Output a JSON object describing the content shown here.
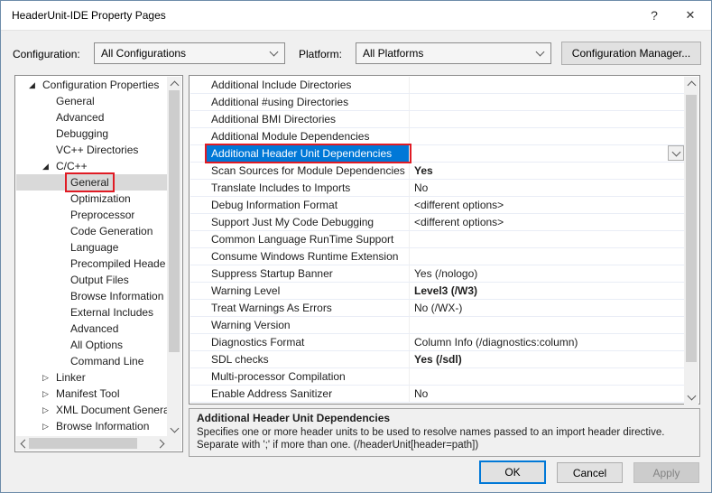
{
  "window": {
    "title": "HeaderUnit-IDE Property Pages",
    "help_icon": "?",
    "close_icon": "✕"
  },
  "toolbar": {
    "configuration_label": "Configuration:",
    "configuration_value": "All Configurations",
    "platform_label": "Platform:",
    "platform_value": "All Platforms",
    "configuration_manager_label": "Configuration Manager..."
  },
  "tree": {
    "items": [
      {
        "label": "Configuration Properties",
        "level": 0,
        "expander": "expanded"
      },
      {
        "label": "General",
        "level": 1,
        "expander": "none"
      },
      {
        "label": "Advanced",
        "level": 1,
        "expander": "none"
      },
      {
        "label": "Debugging",
        "level": 1,
        "expander": "none"
      },
      {
        "label": "VC++ Directories",
        "level": 1,
        "expander": "none"
      },
      {
        "label": "C/C++",
        "level": 1,
        "expander": "expanded"
      },
      {
        "label": "General",
        "level": 2,
        "expander": "none",
        "selected": true,
        "redbox": true
      },
      {
        "label": "Optimization",
        "level": 2,
        "expander": "none"
      },
      {
        "label": "Preprocessor",
        "level": 2,
        "expander": "none"
      },
      {
        "label": "Code Generation",
        "level": 2,
        "expander": "none"
      },
      {
        "label": "Language",
        "level": 2,
        "expander": "none"
      },
      {
        "label": "Precompiled Heade",
        "level": 2,
        "expander": "none"
      },
      {
        "label": "Output Files",
        "level": 2,
        "expander": "none"
      },
      {
        "label": "Browse Information",
        "level": 2,
        "expander": "none"
      },
      {
        "label": "External Includes",
        "level": 2,
        "expander": "none"
      },
      {
        "label": "Advanced",
        "level": 2,
        "expander": "none"
      },
      {
        "label": "All Options",
        "level": 2,
        "expander": "none"
      },
      {
        "label": "Command Line",
        "level": 2,
        "expander": "none"
      },
      {
        "label": "Linker",
        "level": 1,
        "expander": "collapsed"
      },
      {
        "label": "Manifest Tool",
        "level": 1,
        "expander": "collapsed"
      },
      {
        "label": "XML Document Genera",
        "level": 1,
        "expander": "collapsed"
      },
      {
        "label": "Browse Information",
        "level": 1,
        "expander": "collapsed"
      }
    ]
  },
  "grid": {
    "rows": [
      {
        "name": "Additional Include Directories",
        "value": ""
      },
      {
        "name": "Additional #using Directories",
        "value": ""
      },
      {
        "name": "Additional BMI Directories",
        "value": ""
      },
      {
        "name": "Additional Module Dependencies",
        "value": ""
      },
      {
        "name": "Additional Header Unit Dependencies",
        "value": "",
        "selected": true,
        "redbox": true,
        "dropdown": true
      },
      {
        "name": "Scan Sources for Module Dependencies",
        "value": "Yes",
        "bold": true
      },
      {
        "name": "Translate Includes to Imports",
        "value": "No"
      },
      {
        "name": "Debug Information Format",
        "value": "<different options>"
      },
      {
        "name": "Support Just My Code Debugging",
        "value": "<different options>"
      },
      {
        "name": "Common Language RunTime Support",
        "value": ""
      },
      {
        "name": "Consume Windows Runtime Extension",
        "value": ""
      },
      {
        "name": "Suppress Startup Banner",
        "value": "Yes (/nologo)"
      },
      {
        "name": "Warning Level",
        "value": "Level3 (/W3)",
        "bold": true
      },
      {
        "name": "Treat Warnings As Errors",
        "value": "No (/WX-)"
      },
      {
        "name": "Warning Version",
        "value": ""
      },
      {
        "name": "Diagnostics Format",
        "value": "Column Info (/diagnostics:column)"
      },
      {
        "name": "SDL checks",
        "value": "Yes (/sdl)",
        "bold": true
      },
      {
        "name": "Multi-processor Compilation",
        "value": ""
      },
      {
        "name": "Enable Address Sanitizer",
        "value": "No"
      }
    ]
  },
  "description": {
    "title": "Additional Header Unit Dependencies",
    "line1": "Specifies one or more header units to be used to resolve names passed to an import header directive.",
    "line2": "Separate with ';' if more than one.  (/headerUnit[header=path])"
  },
  "footer": {
    "ok_label": "OK",
    "cancel_label": "Cancel",
    "apply_label": "Apply"
  },
  "colors": {
    "accent": "#0078d7",
    "annotation_red": "#e01b24",
    "tree_selection": "#d9d9d9"
  }
}
